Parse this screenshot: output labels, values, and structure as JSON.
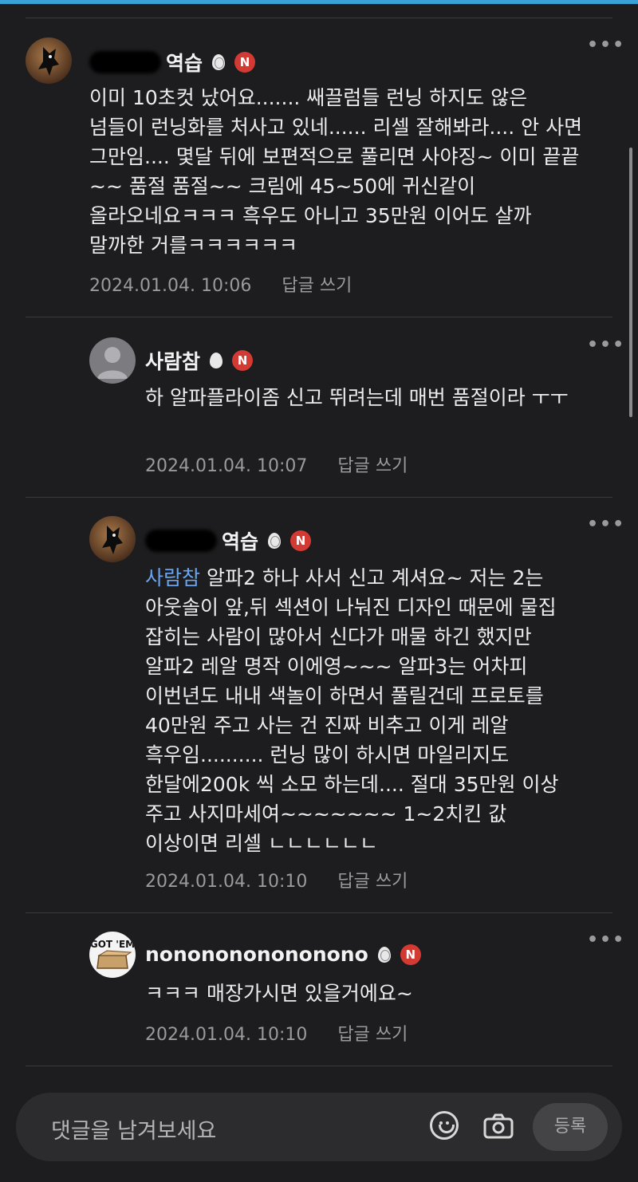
{
  "comments": [
    {
      "author_suffix": "역습",
      "egg_style": "ring",
      "badge": "N",
      "mention": "",
      "text": "이미 10초컷 났어요....... 쌔끌럼들 런닝 하지도 않은 넘들이 런닝화를 처사고 있네...... 리셀 잘해봐라.... 안 사면 그만임.... 몇달 뒤에 보편적으로 풀리면 사야징~ 이미 끝끝~~ 품절 품절~~ 크림에 45~50에 귀신같이 올라오네요ㅋㅋㅋ 흑우도 아니고 35만원 이어도 살까 말까한 거를ㅋㅋㅋㅋㅋㅋ",
      "date": "2024.01.04. 10:06",
      "reply": "답글 쓰기",
      "avatar_icon": "masked-character-avatar"
    },
    {
      "author": "사람참",
      "egg_style": "plain",
      "badge": "N",
      "mention": "",
      "text": "하 알파플라이좀 신고 뛰려는데 매번 품절이라 ㅜㅜ",
      "date": "2024.01.04. 10:07",
      "reply": "답글 쓰기",
      "avatar_icon": "default-user-avatar"
    },
    {
      "author_suffix": "역습",
      "egg_style": "ring",
      "badge": "N",
      "mention": "사람참",
      "text": " 알파2 하나 사서 신고 계셔요~ 저는 2는 아웃솔이 앞,뒤 섹션이 나눠진 디자인 때문에 물집 잡히는 사람이 많아서 신다가 매물 하긴 했지만 알파2 레알 명작 이에영~~~ 알파3는 어차피 이번년도 내내 색놀이 하면서 풀릴건데 프로토를 40만원 주고 사는 건 진짜 비추고 이게 레알 흑우임.......... 런닝 많이 하시면 마일리지도 한달에200k 씩 소모 하는데.... 절대 35만원 이상 주고 사지마세여~~~~~~~ 1~2치킨 값 이상이면 리셀 ㄴㄴㄴㄴㄴㄴ",
      "date": "2024.01.04. 10:10",
      "reply": "답글 쓰기",
      "avatar_icon": "masked-character-avatar"
    },
    {
      "author": "nononononononono",
      "egg_style": "ring",
      "badge": "N",
      "mention": "",
      "text": "ㅋㅋㅋ 매장가시면 있을거에요~",
      "date": "2024.01.04. 10:10",
      "reply": "답글 쓰기",
      "avatar_icon": "got-em-logo-avatar"
    }
  ],
  "more_glyph": "•••",
  "avatar_logo_text": "GOT 'EM",
  "composer": {
    "placeholder": "댓글을 남겨보세요",
    "submit_label": "등록",
    "emoji_icon": "smile-icon",
    "camera_icon": "camera-icon"
  },
  "colors": {
    "background": "#1d1d1f",
    "mention": "#6aa4ee",
    "badge": "#d33a33",
    "top_accent": "#3aa0d8"
  }
}
